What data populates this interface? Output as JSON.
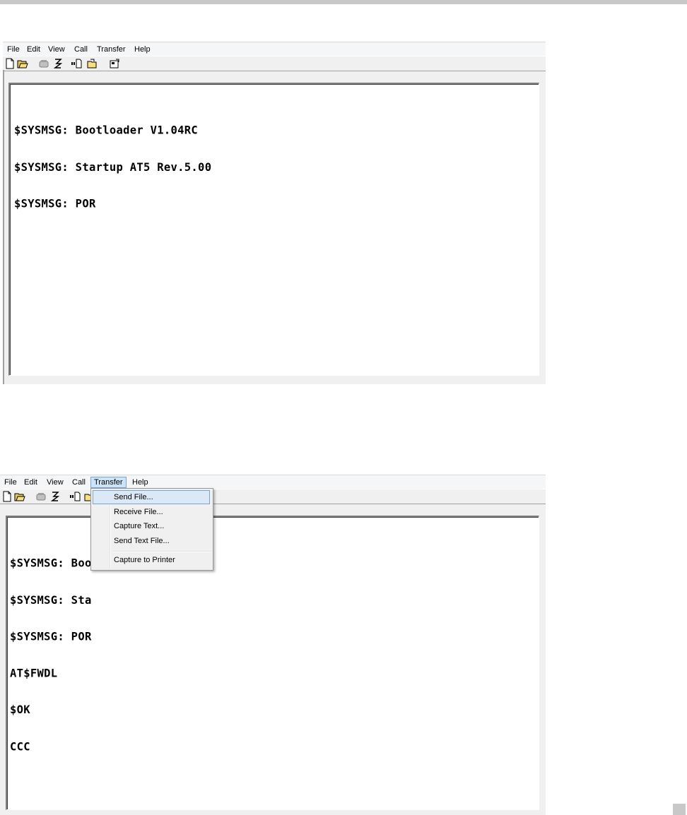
{
  "menubar": {
    "items": [
      "File",
      "Edit",
      "View",
      "Call",
      "Transfer",
      "Help"
    ]
  },
  "toolbar": {
    "icons": [
      "new-icon",
      "open-icon",
      "disconnect-icon",
      "dial-icon",
      "send-icon",
      "receive-icon",
      "properties-icon"
    ]
  },
  "window1": {
    "terminal_lines": [
      "$SYSMSG: Bootloader V1.04RC",
      "$SYSMSG: Startup AT5 Rev.5.00",
      "$SYSMSG: POR"
    ]
  },
  "window2": {
    "active_menu": "Transfer",
    "terminal_lines": [
      "$SYSMSG: Boo",
      "$SYSMSG: Sta",
      "$SYSMSG: POR",
      "AT$FWDL",
      "$OK",
      "CCC"
    ],
    "transfer_menu": {
      "options": [
        "Send File...",
        "Receive File...",
        "Capture Text...",
        "Send Text File..."
      ],
      "separator_option": "Capture to Printer",
      "highlighted": "Send File..."
    }
  }
}
